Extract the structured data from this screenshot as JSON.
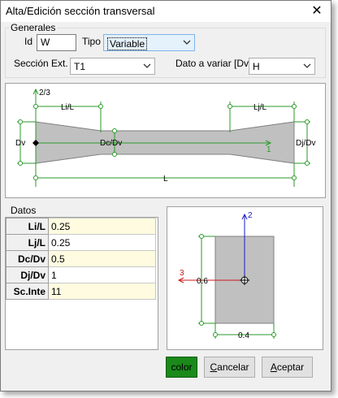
{
  "window": {
    "title": "Alta/Edición sección transversal",
    "close_glyph": "✕"
  },
  "generales": {
    "label": "Generales",
    "id_label": "Id",
    "id_value": "W",
    "tipo_label": "Tipo",
    "tipo_value": "Variable",
    "seccion_label": "Sección Ext. I",
    "seccion_value": "T1",
    "dato_label": "Dato a variar [Dv]",
    "dato_value": "H"
  },
  "profile_diagram": {
    "top_label": "2/3",
    "li_label": "Li/L",
    "lj_label": "Lj/L",
    "dv_label": "Dv",
    "dc_label": "Dc/Dv",
    "dj_label": "Dj/Dv",
    "axis1_label": "1",
    "l_label": "L"
  },
  "datos": {
    "label": "Datos",
    "rows": [
      {
        "name": "Li/L",
        "value": "0.25"
      },
      {
        "name": "Lj/L",
        "value": "0.25"
      },
      {
        "name": "Dc/Dv",
        "value": "0.5"
      },
      {
        "name": "Dj/Dv",
        "value": "1"
      },
      {
        "name": "Sc.Inte",
        "value": "11"
      }
    ]
  },
  "section_diagram": {
    "axis2_label": "2",
    "axis3_label": "3",
    "height_label": "0.6",
    "width_label": "0.4"
  },
  "buttons": {
    "color": "color",
    "cancel": "Cancelar",
    "cancel_mnemonic": "C",
    "cancel_rest": "ancelar",
    "accept": "Aceptar",
    "accept_mnemonic": "A",
    "accept_rest": "ceptar"
  },
  "colors": {
    "section_fill": "#c0c0c0",
    "axis_green": "#2a9a2a",
    "axis_blue": "#1a1acc",
    "axis_red": "#cc1a1a",
    "color_button": "#1a8a1a",
    "grid_highlight": "#fffbe0"
  }
}
